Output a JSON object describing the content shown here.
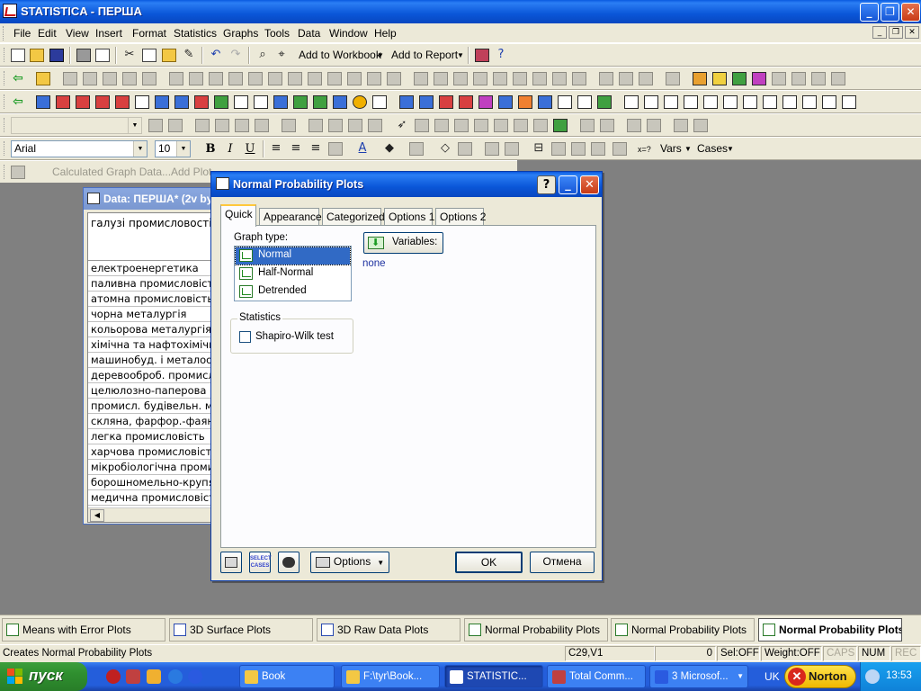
{
  "app": {
    "title": "STATISTICA - ПЕРША",
    "window_controls": [
      "_",
      "❐",
      "✕"
    ]
  },
  "menu": {
    "items": [
      "File",
      "Edit",
      "View",
      "Insert",
      "Format",
      "Statistics",
      "Graphs",
      "Tools",
      "Data",
      "Window",
      "Help"
    ]
  },
  "toolbar": {
    "add_to_workbook": "Add to Workbook",
    "add_to_report": "Add to Report",
    "font_name": "Arial",
    "font_size": "10",
    "bold": "B",
    "italic": "I",
    "underline": "U",
    "vars": "Vars",
    "cases": "Cases",
    "calculated_graph_data": "Calculated Graph Data...",
    "add_plot": "Add Plot..."
  },
  "spreadsheet": {
    "title": "Data: ПЕРША* (2v by",
    "column_header": "галузі промисловості",
    "rows": [
      "електроенергетика",
      "паливна промисловість",
      "атомна промисловість",
      "чорна металургія",
      "кольорова металургія",
      "хімічна та нафтохімічна",
      "машинобуд. і металообр.",
      "деревооброб. промисл.",
      "целюлозно-паперова",
      "промисл. будівельн. мат.",
      "скляна, фарфор.-фаянс.",
      "легка промисловість",
      "харчова промисловість",
      "мікробіологічна промисл.",
      "борошномельно-крупяна",
      "медична промисловість"
    ]
  },
  "dialog": {
    "title": "Normal Probability Plots",
    "tabs": [
      "Quick",
      "Appearance",
      "Categorized",
      "Options 1",
      "Options 2"
    ],
    "active_tab": "Quick",
    "graph_type_label": "Graph type:",
    "graph_types": [
      "Normal",
      "Half-Normal",
      "Detrended"
    ],
    "selected_graph_type": "Normal",
    "variables_button": "Variables:",
    "variables_value": "none",
    "statistics_group": "Statistics",
    "shapiro_wilk_label": "Shapiro-Wilk test",
    "shapiro_wilk_checked": false,
    "select_cases_label": "SELECT CASES",
    "options_button": "Options",
    "ok_button": "OK",
    "cancel_button": "Отмена"
  },
  "window_tabs": [
    "Means with Error Plots",
    "3D Surface Plots",
    "3D Raw Data Plots",
    "Normal Probability Plots",
    "Normal Probability Plots",
    "Normal Probability Plots"
  ],
  "statusbar": {
    "message": "Creates Normal Probability Plots",
    "cell": "C29,V1",
    "value": "0",
    "sel": "Sel:OFF",
    "weight": "Weight:OFF",
    "caps": "CAPS",
    "num": "NUM",
    "rec": "REC"
  },
  "taskbar": {
    "start": "пуск",
    "tasks": [
      "Book",
      "F:\\tyr\\Book...",
      "STATISTIC...",
      "Total Comm...",
      "3 Microsof..."
    ],
    "active_task": "STATISTIC...",
    "language": "UK",
    "norton": "Norton",
    "time": "13:53"
  },
  "colors": {
    "xp_blue": "#0a56d8",
    "selection": "#316ac5",
    "start_green": "#2f8f2f",
    "dialog_bg": "#ece9d8"
  }
}
